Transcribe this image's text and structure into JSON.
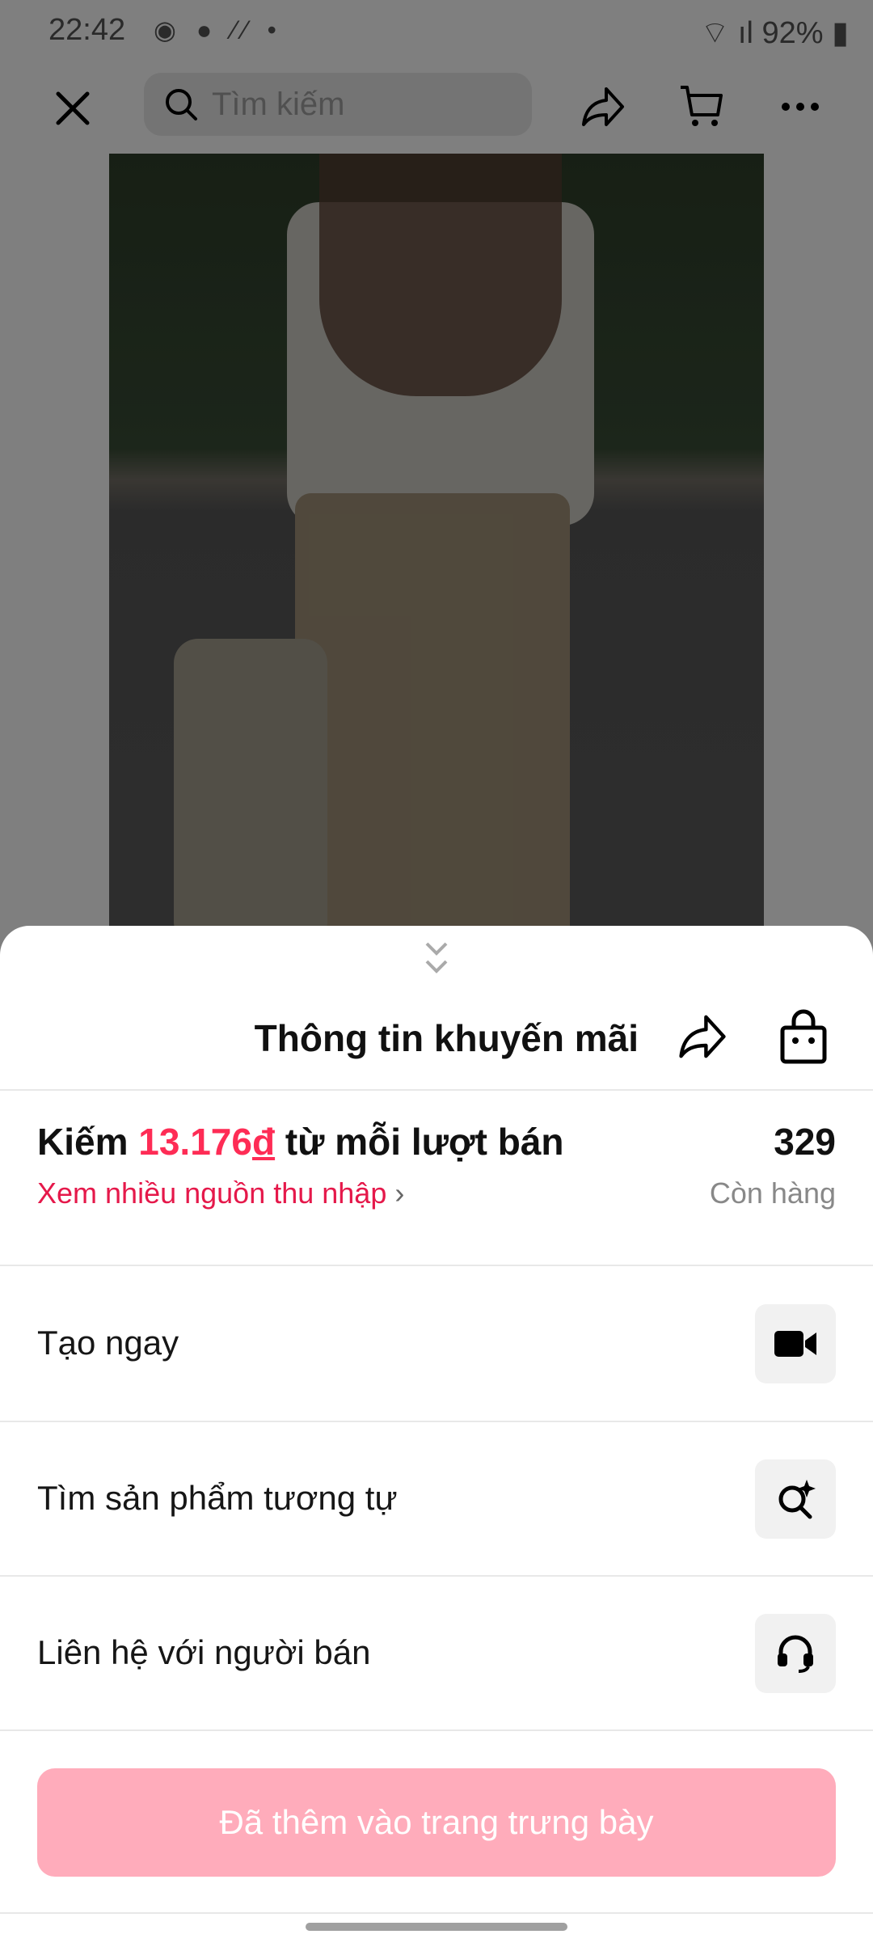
{
  "status_bar": {
    "time": "22:42",
    "battery": "92%",
    "notification_icons": [
      "messenger-icon",
      "chat-icon",
      "signal-bars-icon",
      "dot-icon"
    ]
  },
  "top_bar": {
    "search_placeholder": "Tìm kiếm"
  },
  "sheet": {
    "title": "Thông tin khuyến mãi",
    "earn_prefix": "Kiếm ",
    "earn_amount": "13.176",
    "earn_currency": "đ",
    "earn_suffix": " từ mỗi lượt bán",
    "more_income": "Xem nhiều nguồn thu nhập",
    "stock_count": "329",
    "stock_label": "Còn hàng",
    "actions": [
      {
        "label": "Tạo ngay",
        "icon": "video-camera-icon"
      },
      {
        "label": "Tìm sản phẩm tương tự",
        "icon": "search-sparkle-icon"
      },
      {
        "label": "Liên hệ với người bán",
        "icon": "headset-icon"
      }
    ],
    "cta": "Đã thêm vào trang trưng bày"
  },
  "colors": {
    "accent": "#fe2c55",
    "cta_disabled": "#ffacbb"
  }
}
